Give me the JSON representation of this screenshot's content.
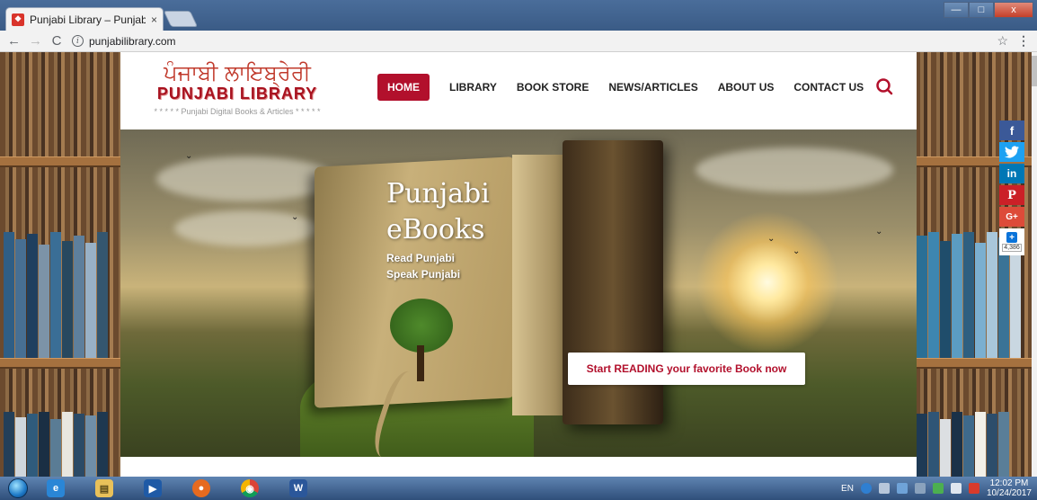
{
  "browser": {
    "tab_title": "Punjabi Library – Punjab",
    "tab_close": "×",
    "url": "punjabilibrary.com",
    "nav": {
      "back": "←",
      "forward": "→",
      "reload": "C"
    },
    "star": "☆",
    "menu": "⋮",
    "window_controls": {
      "minimize": "—",
      "maximize": "□",
      "close": "x"
    }
  },
  "site": {
    "logo_gurmukhi": "ਪੰਜਾਬੀ ਲਾਇਬ੍ਰੇਰੀ",
    "logo_latin": "PUNJABI LIBRARY",
    "logo_tagline": "* * * * * Punjabi Digital Books & Articles * * * * *",
    "menu": [
      {
        "label": "HOME",
        "active": true
      },
      {
        "label": "LIBRARY",
        "active": false
      },
      {
        "label": "BOOK STORE",
        "active": false
      },
      {
        "label": "NEWS/ARTICLES",
        "active": false
      },
      {
        "label": "ABOUT US",
        "active": false
      },
      {
        "label": "CONTACT US",
        "active": false
      }
    ],
    "hero": {
      "title_line1": "Punjabi",
      "title_line2": "eBooks",
      "sub_line1": "Read Punjabi",
      "sub_line2": "Speak Punjabi",
      "cta": "Start READING your favorite Book now"
    },
    "social": {
      "facebook": "f",
      "twitter": "t",
      "linkedin": "in",
      "pinterest": "P",
      "googleplus": "G+",
      "share_plus": "+",
      "share_count": "4,386"
    },
    "colors": {
      "brand_red": "#b2102c",
      "logo_red": "#c0392b"
    }
  },
  "taskbar": {
    "apps": [
      {
        "name": "internet-explorer",
        "glyph": "e"
      },
      {
        "name": "file-explorer",
        "glyph": "▤"
      },
      {
        "name": "media-player",
        "glyph": "▶"
      },
      {
        "name": "firefox",
        "glyph": "●"
      },
      {
        "name": "chrome",
        "glyph": "◉"
      },
      {
        "name": "word",
        "glyph": "W"
      }
    ],
    "language": "EN",
    "time": "12:02 PM",
    "date": "10/24/2017"
  }
}
